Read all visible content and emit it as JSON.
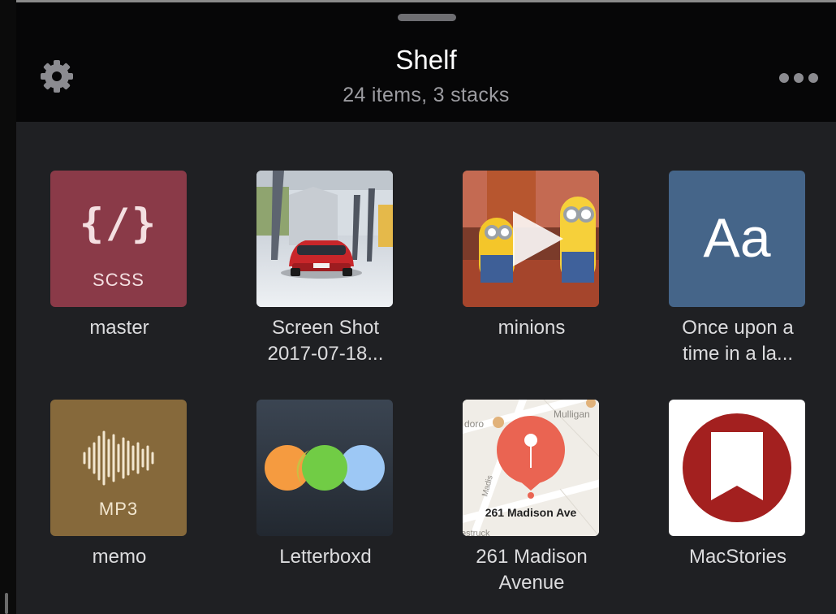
{
  "header": {
    "title": "Shelf",
    "subtitle": "24 items, 3 stacks",
    "settings_icon": "gear-icon",
    "more_icon": "ellipsis-icon"
  },
  "colors": {
    "scss_tile": "#8a3a48",
    "mp3_tile": "#86693b",
    "text_tile": "#456589",
    "macstories_red": "#a3201f"
  },
  "items": [
    {
      "caption_1": "master",
      "caption_2": "",
      "badge": "SCSS",
      "glyph": "{/}",
      "icon": "code-file-icon"
    },
    {
      "caption_1": "Screen Shot",
      "caption_2": "2017-07-18...",
      "icon": "car-photo-thumbnail"
    },
    {
      "caption_1": "minions",
      "caption_2": "",
      "icon": "play-icon"
    },
    {
      "caption_1": "Once upon a",
      "caption_2": "time in a la...",
      "glyph": "Aa",
      "icon": "text-snippet-icon"
    },
    {
      "caption_1": "memo",
      "caption_2": "",
      "badge": "MP3",
      "icon": "waveform-icon"
    },
    {
      "caption_1": "Letterboxd",
      "caption_2": "",
      "icon": "letterboxd-dots-icon"
    },
    {
      "caption_1": "261 Madison",
      "caption_2": "Avenue",
      "icon": "map-pin-icon",
      "map": {
        "pin_label": "261 Madison Ave",
        "street_top_left": "doro",
        "street_top_right": "Mulligan",
        "street_left": "Madis",
        "street_bottom": "estruck"
      }
    },
    {
      "caption_1": "MacStories",
      "caption_2": "",
      "icon": "bookmark-icon"
    }
  ]
}
